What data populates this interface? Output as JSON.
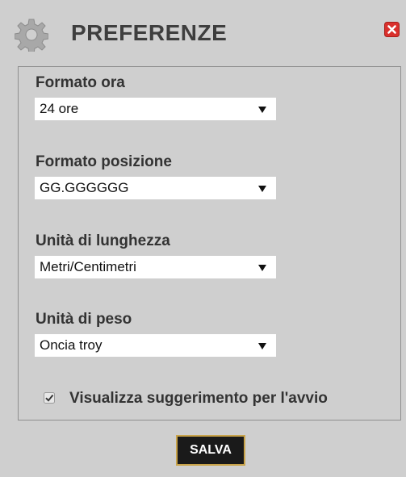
{
  "header": {
    "title": "PREFERENZE",
    "gear_icon": "gear-icon",
    "close_icon": "close-icon"
  },
  "fields": [
    {
      "label": "Formato ora",
      "selected": "24 ore"
    },
    {
      "label": "Formato posizione",
      "selected": "GG.GGGGGG"
    },
    {
      "label": "Unità di lunghezza",
      "selected": "Metri/Centimetri"
    },
    {
      "label": "Unità di peso",
      "selected": "Oncia troy"
    }
  ],
  "startup_tip": {
    "label": "Visualizza suggerimento per l'avvio",
    "checked": true
  },
  "footer": {
    "save_label": "SALVA"
  },
  "colors": {
    "background": "#cfcfcf",
    "title_text": "#3e3e3e",
    "close_red": "#d9302c",
    "save_bg": "#1a1a1a",
    "save_border": "#c8a34a"
  }
}
